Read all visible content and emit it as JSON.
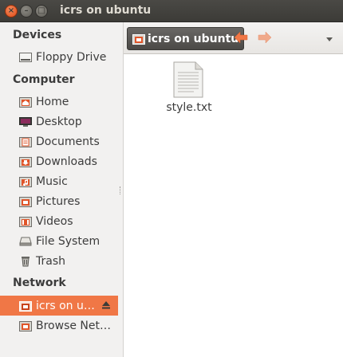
{
  "window": {
    "title": "icrs on ubuntu",
    "close_glyph": "×",
    "minimize_glyph": "–",
    "maximize_glyph": "□"
  },
  "sidebar": {
    "sections": [
      {
        "label": "Devices"
      },
      {
        "label": "Computer"
      },
      {
        "label": "Network"
      }
    ],
    "devices": [
      {
        "label": "Floppy Drive",
        "icon": "floppy-drive-icon"
      }
    ],
    "computer": [
      {
        "label": "Home",
        "icon": "home-folder-icon"
      },
      {
        "label": "Desktop",
        "icon": "desktop-icon"
      },
      {
        "label": "Documents",
        "icon": "documents-folder-icon"
      },
      {
        "label": "Downloads",
        "icon": "downloads-folder-icon"
      },
      {
        "label": "Music",
        "icon": "music-folder-icon"
      },
      {
        "label": "Pictures",
        "icon": "pictures-folder-icon"
      },
      {
        "label": "Videos",
        "icon": "videos-folder-icon"
      },
      {
        "label": "File System",
        "icon": "file-system-icon"
      },
      {
        "label": "Trash",
        "icon": "trash-icon"
      }
    ],
    "network": [
      {
        "label": "icrs on u…",
        "icon": "network-share-icon",
        "selected": true
      },
      {
        "label": "Browse Net…",
        "icon": "browse-network-icon"
      }
    ]
  },
  "toolbar": {
    "path_label": "icrs on ubuntu",
    "back_icon": "back-arrow-icon",
    "forward_icon": "forward-arrow-icon",
    "menu_icon": "dropdown-arrow-icon"
  },
  "files": [
    {
      "name": "style.txt",
      "icon": "text-file-icon"
    }
  ],
  "colors": {
    "titlebar": "#3c3b37",
    "selection": "#f07746",
    "close_button": "#df4a16",
    "arrow_accent": "#f07746"
  }
}
